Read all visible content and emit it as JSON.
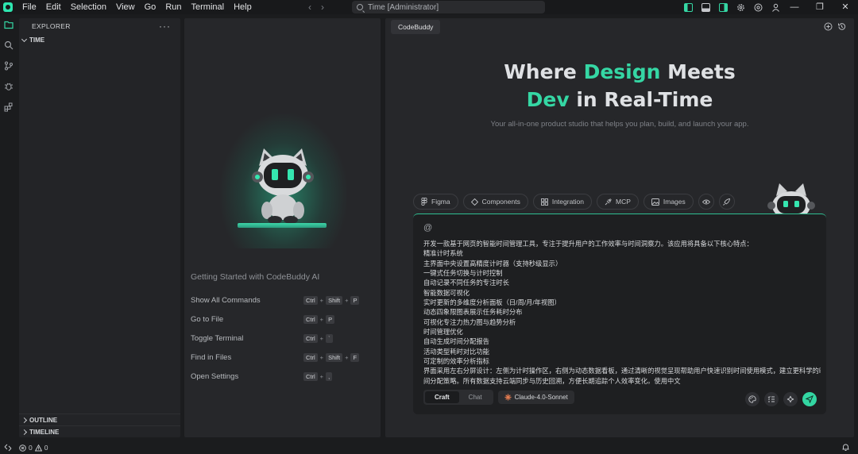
{
  "titlebar": {
    "menu": [
      "File",
      "Edit",
      "Selection",
      "View",
      "Go",
      "Run",
      "Terminal",
      "Help"
    ],
    "search_text": "Time [Administrator]"
  },
  "explorer": {
    "header": "EXPLORER",
    "more": "···",
    "root_folder": "TIME",
    "outline": "OUTLINE",
    "timeline": "TIMELINE"
  },
  "welcome": {
    "title": "Getting Started with CodeBuddy AI",
    "shortcuts": [
      {
        "label": "Show All Commands",
        "keys": [
          "Ctrl",
          "Shift",
          "P"
        ]
      },
      {
        "label": "Go to File",
        "keys": [
          "Ctrl",
          "P"
        ]
      },
      {
        "label": "Toggle Terminal",
        "keys": [
          "Ctrl",
          "`"
        ]
      },
      {
        "label": "Find in Files",
        "keys": [
          "Ctrl",
          "Shift",
          "F"
        ]
      },
      {
        "label": "Open Settings",
        "keys": [
          "Ctrl",
          ","
        ]
      }
    ]
  },
  "codebuddy": {
    "tab": "CodeBuddy",
    "hero_where": "Where ",
    "hero_design": "Design",
    "hero_meets": " Meets",
    "hero_dev": "Dev",
    "hero_rest": " in Real-Time",
    "tagline": "Your all-in-one product studio that helps you plan, build, and launch your app.",
    "chips": [
      "Figma",
      "Components",
      "Integration",
      "MCP",
      "Images"
    ],
    "prompt_at": "@",
    "prompt_lines": [
      "开发一款基于网页的智能时间管理工具，专注于提升用户的工作效率与时间洞察力。该应用将具备以下核心特点：",
      "精准计时系统",
      "主界面中央设置高精度计时器（支持秒级显示）",
      "一键式任务切换与计时控制",
      "自动记录不同任务的专注时长",
      "智能数据可视化",
      "实时更新的多维度分析面板（日/周/月/年视图）",
      "动态四象限图表展示任务耗时分布",
      "可视化专注力热力图与趋势分析",
      "时间管理优化",
      "自动生成时间分配报告",
      "活动类型耗时对比功能",
      "可定制的效率分析指标",
      "界面采用左右分屏设计：左侧为计时操作区，右侧为动态数据看板，通过清晰的视觉呈现帮助用户快速识别时间使用模式，建立更科学的时",
      "间分配策略。所有数据支持云端同步与历史回溯，方便长期追踪个人效率变化。使用中文"
    ],
    "mode_craft": "Craft",
    "mode_chat": "Chat",
    "model": "Claude-4.0-Sonnet"
  },
  "statusbar": {
    "errors": "0",
    "warnings": "0"
  },
  "colors": {
    "accent": "#35d7a4",
    "background": "#1b1c1e",
    "panel": "#26272a"
  }
}
